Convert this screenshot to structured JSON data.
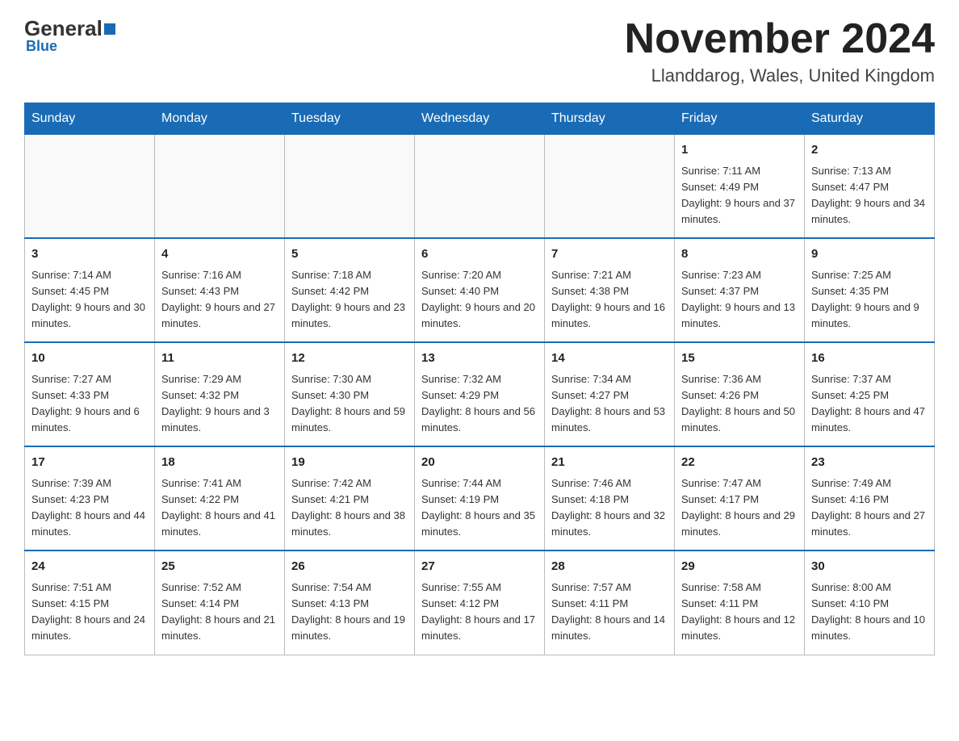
{
  "logo": {
    "general": "General",
    "blue": "Blue",
    "subtitle": "Blue"
  },
  "header": {
    "month_year": "November 2024",
    "location": "Llanddarog, Wales, United Kingdom"
  },
  "days_of_week": [
    "Sunday",
    "Monday",
    "Tuesday",
    "Wednesday",
    "Thursday",
    "Friday",
    "Saturday"
  ],
  "weeks": [
    [
      {
        "day": "",
        "info": ""
      },
      {
        "day": "",
        "info": ""
      },
      {
        "day": "",
        "info": ""
      },
      {
        "day": "",
        "info": ""
      },
      {
        "day": "",
        "info": ""
      },
      {
        "day": "1",
        "info": "Sunrise: 7:11 AM\nSunset: 4:49 PM\nDaylight: 9 hours and 37 minutes."
      },
      {
        "day": "2",
        "info": "Sunrise: 7:13 AM\nSunset: 4:47 PM\nDaylight: 9 hours and 34 minutes."
      }
    ],
    [
      {
        "day": "3",
        "info": "Sunrise: 7:14 AM\nSunset: 4:45 PM\nDaylight: 9 hours and 30 minutes."
      },
      {
        "day": "4",
        "info": "Sunrise: 7:16 AM\nSunset: 4:43 PM\nDaylight: 9 hours and 27 minutes."
      },
      {
        "day": "5",
        "info": "Sunrise: 7:18 AM\nSunset: 4:42 PM\nDaylight: 9 hours and 23 minutes."
      },
      {
        "day": "6",
        "info": "Sunrise: 7:20 AM\nSunset: 4:40 PM\nDaylight: 9 hours and 20 minutes."
      },
      {
        "day": "7",
        "info": "Sunrise: 7:21 AM\nSunset: 4:38 PM\nDaylight: 9 hours and 16 minutes."
      },
      {
        "day": "8",
        "info": "Sunrise: 7:23 AM\nSunset: 4:37 PM\nDaylight: 9 hours and 13 minutes."
      },
      {
        "day": "9",
        "info": "Sunrise: 7:25 AM\nSunset: 4:35 PM\nDaylight: 9 hours and 9 minutes."
      }
    ],
    [
      {
        "day": "10",
        "info": "Sunrise: 7:27 AM\nSunset: 4:33 PM\nDaylight: 9 hours and 6 minutes."
      },
      {
        "day": "11",
        "info": "Sunrise: 7:29 AM\nSunset: 4:32 PM\nDaylight: 9 hours and 3 minutes."
      },
      {
        "day": "12",
        "info": "Sunrise: 7:30 AM\nSunset: 4:30 PM\nDaylight: 8 hours and 59 minutes."
      },
      {
        "day": "13",
        "info": "Sunrise: 7:32 AM\nSunset: 4:29 PM\nDaylight: 8 hours and 56 minutes."
      },
      {
        "day": "14",
        "info": "Sunrise: 7:34 AM\nSunset: 4:27 PM\nDaylight: 8 hours and 53 minutes."
      },
      {
        "day": "15",
        "info": "Sunrise: 7:36 AM\nSunset: 4:26 PM\nDaylight: 8 hours and 50 minutes."
      },
      {
        "day": "16",
        "info": "Sunrise: 7:37 AM\nSunset: 4:25 PM\nDaylight: 8 hours and 47 minutes."
      }
    ],
    [
      {
        "day": "17",
        "info": "Sunrise: 7:39 AM\nSunset: 4:23 PM\nDaylight: 8 hours and 44 minutes."
      },
      {
        "day": "18",
        "info": "Sunrise: 7:41 AM\nSunset: 4:22 PM\nDaylight: 8 hours and 41 minutes."
      },
      {
        "day": "19",
        "info": "Sunrise: 7:42 AM\nSunset: 4:21 PM\nDaylight: 8 hours and 38 minutes."
      },
      {
        "day": "20",
        "info": "Sunrise: 7:44 AM\nSunset: 4:19 PM\nDaylight: 8 hours and 35 minutes."
      },
      {
        "day": "21",
        "info": "Sunrise: 7:46 AM\nSunset: 4:18 PM\nDaylight: 8 hours and 32 minutes."
      },
      {
        "day": "22",
        "info": "Sunrise: 7:47 AM\nSunset: 4:17 PM\nDaylight: 8 hours and 29 minutes."
      },
      {
        "day": "23",
        "info": "Sunrise: 7:49 AM\nSunset: 4:16 PM\nDaylight: 8 hours and 27 minutes."
      }
    ],
    [
      {
        "day": "24",
        "info": "Sunrise: 7:51 AM\nSunset: 4:15 PM\nDaylight: 8 hours and 24 minutes."
      },
      {
        "day": "25",
        "info": "Sunrise: 7:52 AM\nSunset: 4:14 PM\nDaylight: 8 hours and 21 minutes."
      },
      {
        "day": "26",
        "info": "Sunrise: 7:54 AM\nSunset: 4:13 PM\nDaylight: 8 hours and 19 minutes."
      },
      {
        "day": "27",
        "info": "Sunrise: 7:55 AM\nSunset: 4:12 PM\nDaylight: 8 hours and 17 minutes."
      },
      {
        "day": "28",
        "info": "Sunrise: 7:57 AM\nSunset: 4:11 PM\nDaylight: 8 hours and 14 minutes."
      },
      {
        "day": "29",
        "info": "Sunrise: 7:58 AM\nSunset: 4:11 PM\nDaylight: 8 hours and 12 minutes."
      },
      {
        "day": "30",
        "info": "Sunrise: 8:00 AM\nSunset: 4:10 PM\nDaylight: 8 hours and 10 minutes."
      }
    ]
  ]
}
